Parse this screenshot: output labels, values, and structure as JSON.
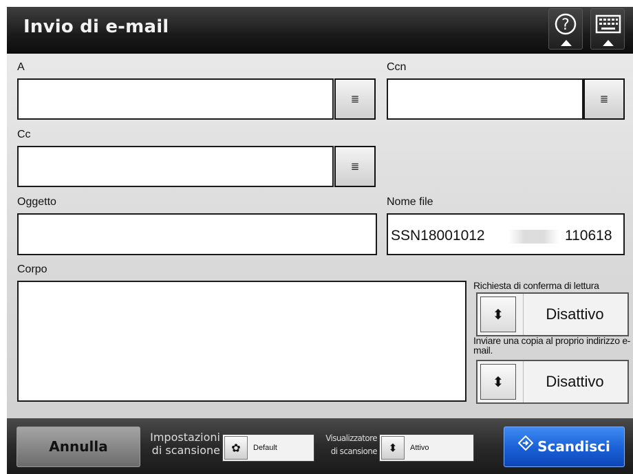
{
  "window": {
    "title": "Invio di e-mail"
  },
  "header": {
    "help_icon": "question-circle-icon",
    "keyboard_icon": "keyboard-icon"
  },
  "fields": {
    "to_label": "A",
    "to_value": "",
    "bcc_label": "Ccn",
    "bcc_value": "",
    "cc_label": "Cc",
    "cc_value": "",
    "subject_label": "Oggetto",
    "subject_value": "",
    "filename_label": "Nome file",
    "filename_value_prefix": "SSN18001012",
    "filename_value_suffix": "110618",
    "body_label": "Corpo",
    "body_value": ""
  },
  "options": {
    "read_receipt_label": "Richiesta di conferma di lettura",
    "read_receipt_value": "Disattivo",
    "send_copy_label": "Inviare una copia al proprio indirizzo e-mail.",
    "send_copy_value": "Disattivo"
  },
  "footer": {
    "cancel_label": "Annulla",
    "scan_settings_label_line1": "Impostazioni",
    "scan_settings_label_line2": "di scansione",
    "scan_settings_value": "Default",
    "scan_viewer_label_line1": "Visualizzatore",
    "scan_viewer_label_line2": "di scansione",
    "scan_viewer_value": "Attivo",
    "scan_label": "Scandisci"
  },
  "colors": {
    "titlebar": "#1b1b1b",
    "scan_button": "#1a5fd6",
    "background": "#d9d9d9"
  }
}
